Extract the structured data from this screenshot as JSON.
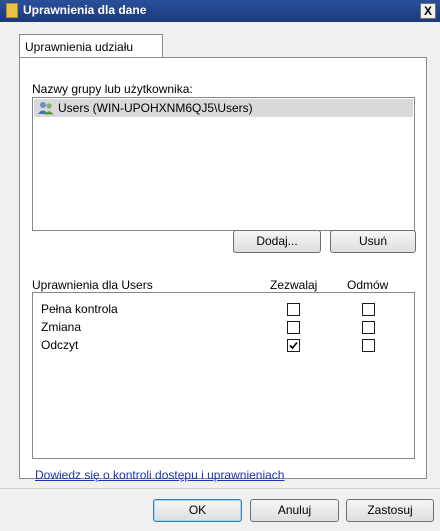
{
  "window": {
    "title": "Uprawnienia dla dane",
    "close_label": "X"
  },
  "tabs": [
    {
      "label": "Uprawnienia udziału"
    }
  ],
  "groups": {
    "label": "Nazwy grupy lub użytkownika:",
    "items": [
      {
        "label": "Users (WIN-UPOHXNM6QJ5\\Users)",
        "icon": "users-icon",
        "selected": true
      }
    ]
  },
  "group_buttons": {
    "add": "Dodaj...",
    "remove": "Usuń"
  },
  "permissions": {
    "header_label": "Uprawnienia dla Users",
    "allow_header": "Zezwalaj",
    "deny_header": "Odmów",
    "rows": [
      {
        "name": "Pełna kontrola",
        "allow": false,
        "deny": false
      },
      {
        "name": "Zmiana",
        "allow": false,
        "deny": false
      },
      {
        "name": "Odczyt",
        "allow": true,
        "deny": false
      }
    ]
  },
  "link": {
    "label": "Dowiedz się o kontroli dostępu i uprawnieniach"
  },
  "footer": {
    "ok": "OK",
    "cancel": "Anuluj",
    "apply": "Zastosuj"
  }
}
